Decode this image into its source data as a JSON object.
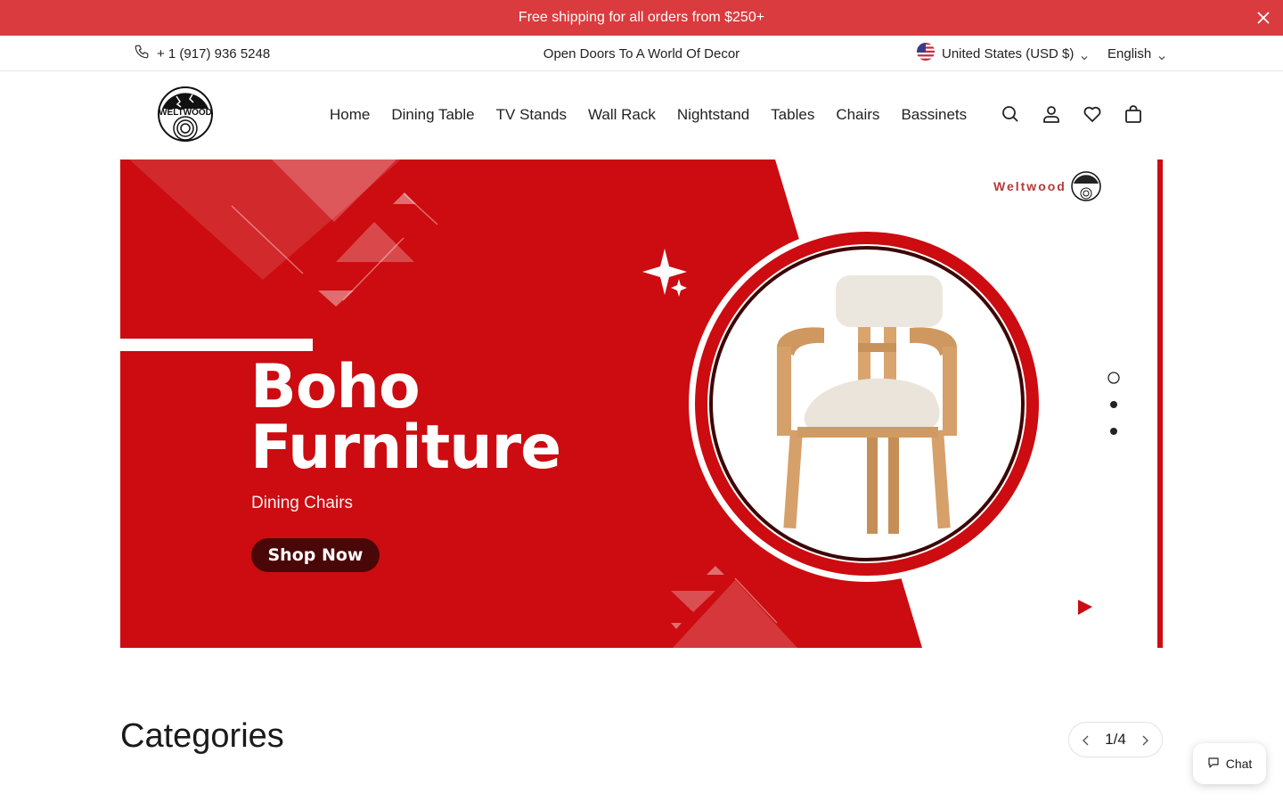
{
  "announcement": {
    "text": "Free shipping for all orders from $250+",
    "close_icon": "close-icon"
  },
  "utility": {
    "phone": "+ 1 (917) 936 5248",
    "tagline": "Open Doors To A World Of Decor",
    "country": "United States (USD $)",
    "language": "English"
  },
  "header": {
    "logo_text": "WELTWOOD",
    "nav": [
      "Home",
      "Dining Table",
      "TV Stands",
      "Wall Rack",
      "Nightstand",
      "Tables",
      "Chairs",
      "Bassinets"
    ],
    "icons": [
      "search-icon",
      "account-icon",
      "wishlist-icon",
      "cart-icon"
    ]
  },
  "hero": {
    "title_line1": "Boho",
    "title_line2": "Furniture",
    "subtitle": "Dining Chairs",
    "button": "Shop Now",
    "brand": "Weltwood",
    "slides_total": 3,
    "active_slide": 1
  },
  "categories": {
    "title": "Categories",
    "pager": "1/4"
  },
  "chat": {
    "label": "Chat"
  },
  "colors": {
    "announcement_bg": "#d93b3f",
    "hero_red": "#cc0c10",
    "button_dark": "#4a0707"
  }
}
